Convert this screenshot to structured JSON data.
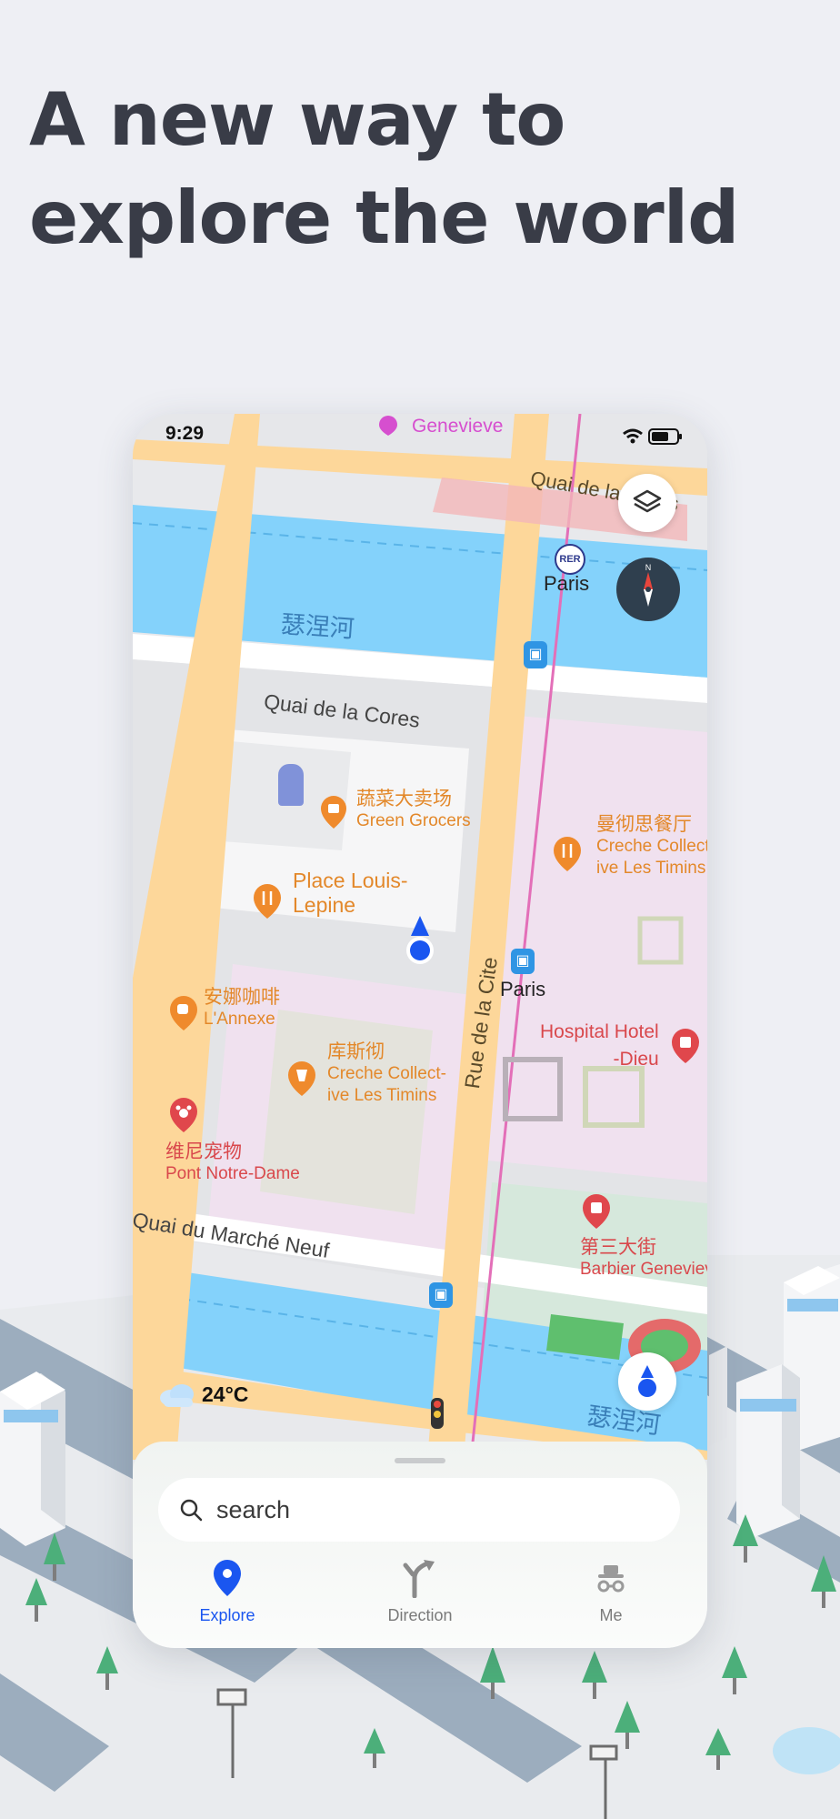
{
  "headline": {
    "line1": "A new way to",
    "line2": "explore the world"
  },
  "status_bar": {
    "time": "9:29"
  },
  "map": {
    "labels": {
      "genevieve": "Genevieve",
      "quai_top": "Quai de la Cores",
      "paris_rer": "Paris",
      "rer_badge": "RER",
      "river_cn": "瑟涅河",
      "quai_middle": "Quai de la  Cores",
      "green_grocers_cn": "蔬菜大卖场",
      "green_grocers_en": "Green Grocers",
      "place_louis_1": "Place Louis-",
      "place_louis_2": "Lepine",
      "creche_right_cn": "曼彻思餐厅",
      "creche_right_en1": "Creche Collect-",
      "creche_right_en2": "ive Les Timins",
      "paris_bus": "Paris",
      "rue_de_la_cite": "Rue de la Cite",
      "annexe_cn": "安娜咖啡",
      "annexe_en": "L'Annexe",
      "kusi_cn": "库斯彻",
      "creche_mid_en1": "Creche Collect-",
      "creche_mid_en2": "ive Les Timins",
      "hospital_1": "Hospital Hotel",
      "hospital_2": "-Dieu",
      "pet_cn": "维尼宠物",
      "pet_en": "Pont Notre-Dame",
      "quai_bottom": "Quai du Marché Neuf",
      "barbier_cn": "第三大街",
      "barbier_en": "Barbier Genevieve",
      "river_cn_bottom": "瑟涅河"
    },
    "weather": {
      "temperature": "24°C"
    }
  },
  "sheet": {
    "search_placeholder": "search",
    "tabs": [
      {
        "label": "Explore",
        "active": true
      },
      {
        "label": "Direction",
        "active": false
      },
      {
        "label": "Me",
        "active": false
      }
    ]
  },
  "colors": {
    "accent": "#1a56f0",
    "water": "#84d2fb",
    "road": "#fdd79a",
    "poi_orange": "#ef8a2c",
    "poi_red": "#e0474c",
    "headline": "#393c47"
  }
}
